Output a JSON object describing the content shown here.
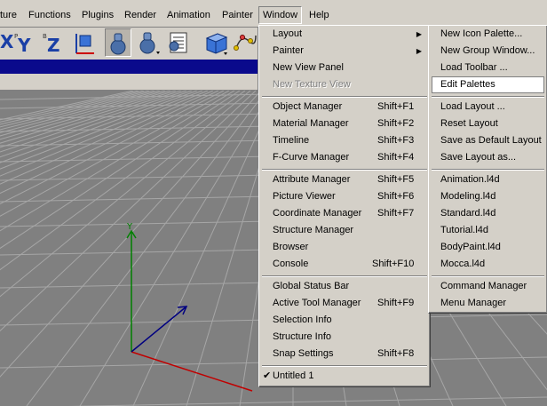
{
  "menubar": {
    "items": [
      "ture",
      "Functions",
      "Plugins",
      "Render",
      "Animation",
      "Painter",
      "Window",
      "Help"
    ]
  },
  "window_menu": {
    "sections": [
      [
        {
          "label": "Layout",
          "shortcut": "",
          "submenu": true
        },
        {
          "label": "Painter",
          "shortcut": "",
          "submenu": true
        },
        {
          "label": "New View Panel",
          "shortcut": ""
        },
        {
          "label": "New Texture View",
          "shortcut": "",
          "disabled": true
        }
      ],
      [
        {
          "label": "Object Manager",
          "shortcut": "Shift+F1"
        },
        {
          "label": "Material Manager",
          "shortcut": "Shift+F2"
        },
        {
          "label": "Timeline",
          "shortcut": "Shift+F3"
        },
        {
          "label": "F-Curve Manager",
          "shortcut": "Shift+F4"
        }
      ],
      [
        {
          "label": "Attribute Manager",
          "shortcut": "Shift+F5"
        },
        {
          "label": "Picture Viewer",
          "shortcut": "Shift+F6"
        },
        {
          "label": "Coordinate Manager",
          "shortcut": "Shift+F7"
        },
        {
          "label": "Structure Manager",
          "shortcut": ""
        },
        {
          "label": "Browser",
          "shortcut": ""
        },
        {
          "label": "Console",
          "shortcut": "Shift+F10"
        }
      ],
      [
        {
          "label": "Global Status Bar",
          "shortcut": ""
        },
        {
          "label": "Active Tool Manager",
          "shortcut": "Shift+F9"
        },
        {
          "label": "Selection Info",
          "shortcut": ""
        },
        {
          "label": "Structure Info",
          "shortcut": ""
        },
        {
          "label": "Snap Settings",
          "shortcut": "Shift+F8"
        }
      ],
      [
        {
          "label": "Untitled 1",
          "shortcut": "",
          "checked": true
        }
      ]
    ]
  },
  "layout_submenu": {
    "sections": [
      [
        {
          "label": "New Icon Palette..."
        },
        {
          "label": "New Group Window..."
        },
        {
          "label": "Load Toolbar ..."
        },
        {
          "label": "Edit Palettes",
          "highlighted": true
        }
      ],
      [
        {
          "label": "Load Layout ..."
        },
        {
          "label": "Reset Layout"
        },
        {
          "label": "Save as Default Layout"
        },
        {
          "label": "Save Layout as..."
        }
      ],
      [
        {
          "label": "Animation.l4d"
        },
        {
          "label": "Modeling.l4d"
        },
        {
          "label": "Standard.l4d"
        },
        {
          "label": "Tutorial.l4d"
        },
        {
          "label": "BodyPaint.l4d"
        },
        {
          "label": "Mocca.l4d"
        }
      ],
      [
        {
          "label": "Command Manager"
        },
        {
          "label": "Menu Manager"
        }
      ]
    ]
  },
  "toolbar": {
    "icons": [
      "x-axis-lock-icon",
      "y-axis-lock-icon",
      "z-axis-lock-icon",
      "coordinate-system-icon",
      "cube-icon",
      "render-active-view-icon",
      "render-in-picture-viewer-icon",
      "render-settings-icon",
      "cube-primitive-icon",
      "spline-icon"
    ]
  },
  "viewport": {
    "axis_y_label": "Y"
  },
  "colors": {
    "menu_bg": "#d4d0c8",
    "title_blue": "#0a0a8c",
    "grid_line": "#a0a0a0",
    "axis_y": "#008000",
    "axis_x": "#c00000",
    "axis_z": "#000080"
  }
}
